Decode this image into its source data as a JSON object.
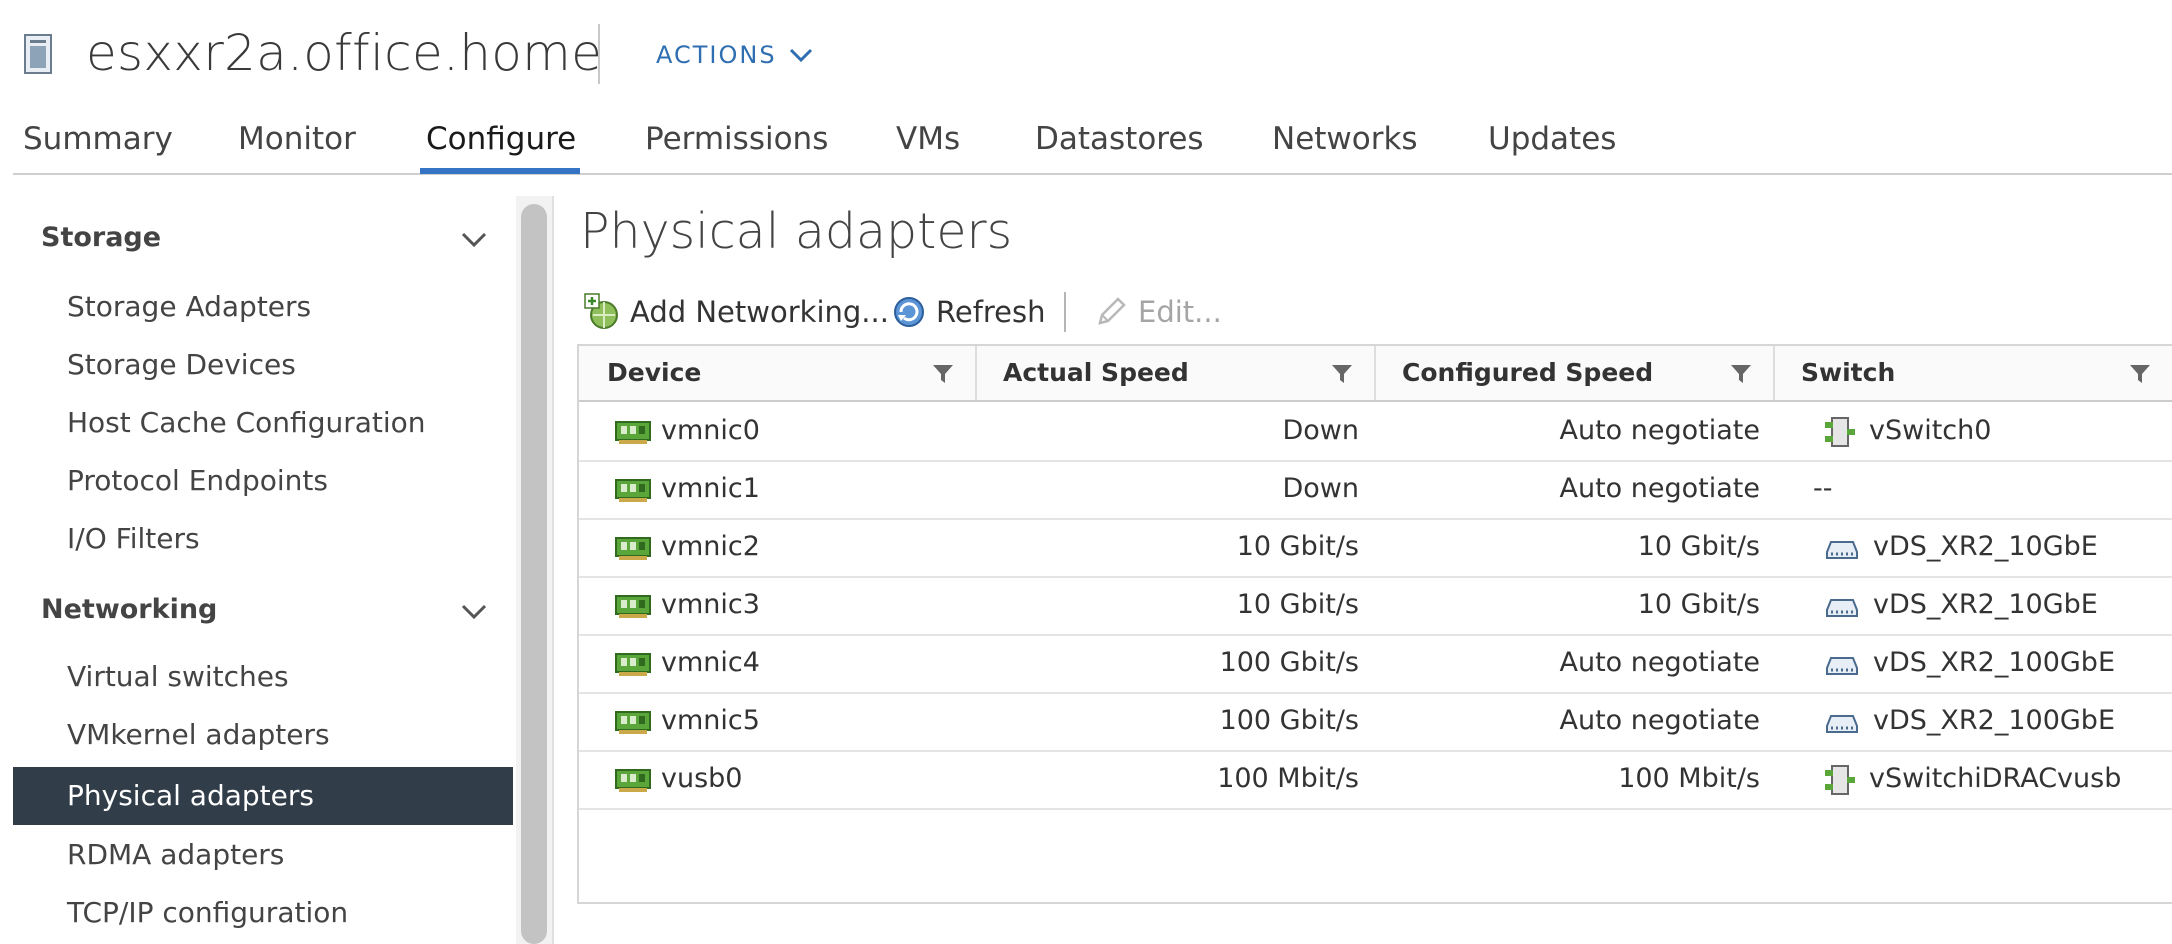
{
  "header": {
    "host_name": "esxxr2a.office.home",
    "actions_label": "ACTIONS"
  },
  "tabs": [
    {
      "label": "Summary",
      "active": false
    },
    {
      "label": "Monitor",
      "active": false
    },
    {
      "label": "Configure",
      "active": true
    },
    {
      "label": "Permissions",
      "active": false
    },
    {
      "label": "VMs",
      "active": false
    },
    {
      "label": "Datastores",
      "active": false
    },
    {
      "label": "Networks",
      "active": false
    },
    {
      "label": "Updates",
      "active": false
    }
  ],
  "sidebar": {
    "sections": [
      {
        "title": "Storage",
        "items": [
          "Storage Adapters",
          "Storage Devices",
          "Host Cache Configuration",
          "Protocol Endpoints",
          "I/O Filters"
        ]
      },
      {
        "title": "Networking",
        "items": [
          "Virtual switches",
          "VMkernel adapters",
          "Physical adapters",
          "RDMA adapters",
          "TCP/IP configuration"
        ]
      }
    ],
    "selected": "Physical adapters"
  },
  "main": {
    "title": "Physical adapters",
    "toolbar": {
      "add_networking": "Add Networking...",
      "refresh": "Refresh",
      "edit": "Edit..."
    },
    "columns": [
      "Device",
      "Actual Speed",
      "Configured Speed",
      "Switch"
    ],
    "rows": [
      {
        "device": "vmnic0",
        "actual_speed": "Down",
        "configured_speed": "Auto negotiate",
        "switch": "vSwitch0",
        "switch_icon": "standard-switch-icon"
      },
      {
        "device": "vmnic1",
        "actual_speed": "Down",
        "configured_speed": "Auto negotiate",
        "switch": "--",
        "switch_icon": ""
      },
      {
        "device": "vmnic2",
        "actual_speed": "10 Gbit/s",
        "configured_speed": "10 Gbit/s",
        "switch": "vDS_XR2_10GbE",
        "switch_icon": "distributed-switch-icon"
      },
      {
        "device": "vmnic3",
        "actual_speed": "10 Gbit/s",
        "configured_speed": "10 Gbit/s",
        "switch": "vDS_XR2_10GbE",
        "switch_icon": "distributed-switch-icon"
      },
      {
        "device": "vmnic4",
        "actual_speed": "100 Gbit/s",
        "configured_speed": "Auto negotiate",
        "switch": "vDS_XR2_100GbE",
        "switch_icon": "distributed-switch-icon"
      },
      {
        "device": "vmnic5",
        "actual_speed": "100 Gbit/s",
        "configured_speed": "Auto negotiate",
        "switch": "vDS_XR2_100GbE",
        "switch_icon": "distributed-switch-icon"
      },
      {
        "device": "vusb0",
        "actual_speed": "100 Mbit/s",
        "configured_speed": "100 Mbit/s",
        "switch": "vSwitchiDRACvusb",
        "switch_icon": "standard-switch-icon"
      }
    ]
  },
  "colors": {
    "accent": "#3574c4",
    "actions": "#2f6eb0",
    "nav_selected_bg": "#313e4a",
    "nic_green": "#4e9a3a"
  }
}
